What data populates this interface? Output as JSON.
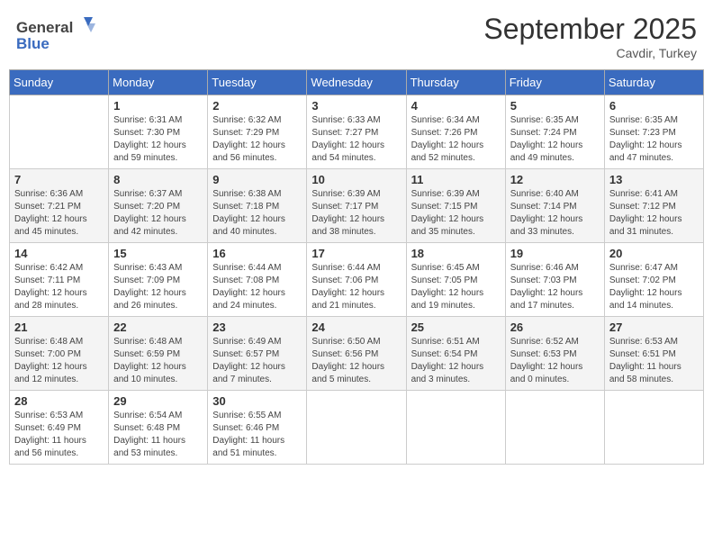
{
  "header": {
    "logo_general": "General",
    "logo_blue": "Blue",
    "month_title": "September 2025",
    "subtitle": "Cavdir, Turkey"
  },
  "weekdays": [
    "Sunday",
    "Monday",
    "Tuesday",
    "Wednesday",
    "Thursday",
    "Friday",
    "Saturday"
  ],
  "weeks": [
    [
      {
        "day": "",
        "sunrise": "",
        "sunset": "",
        "daylight": ""
      },
      {
        "day": "1",
        "sunrise": "Sunrise: 6:31 AM",
        "sunset": "Sunset: 7:30 PM",
        "daylight": "Daylight: 12 hours and 59 minutes."
      },
      {
        "day": "2",
        "sunrise": "Sunrise: 6:32 AM",
        "sunset": "Sunset: 7:29 PM",
        "daylight": "Daylight: 12 hours and 56 minutes."
      },
      {
        "day": "3",
        "sunrise": "Sunrise: 6:33 AM",
        "sunset": "Sunset: 7:27 PM",
        "daylight": "Daylight: 12 hours and 54 minutes."
      },
      {
        "day": "4",
        "sunrise": "Sunrise: 6:34 AM",
        "sunset": "Sunset: 7:26 PM",
        "daylight": "Daylight: 12 hours and 52 minutes."
      },
      {
        "day": "5",
        "sunrise": "Sunrise: 6:35 AM",
        "sunset": "Sunset: 7:24 PM",
        "daylight": "Daylight: 12 hours and 49 minutes."
      },
      {
        "day": "6",
        "sunrise": "Sunrise: 6:35 AM",
        "sunset": "Sunset: 7:23 PM",
        "daylight": "Daylight: 12 hours and 47 minutes."
      }
    ],
    [
      {
        "day": "7",
        "sunrise": "Sunrise: 6:36 AM",
        "sunset": "Sunset: 7:21 PM",
        "daylight": "Daylight: 12 hours and 45 minutes."
      },
      {
        "day": "8",
        "sunrise": "Sunrise: 6:37 AM",
        "sunset": "Sunset: 7:20 PM",
        "daylight": "Daylight: 12 hours and 42 minutes."
      },
      {
        "day": "9",
        "sunrise": "Sunrise: 6:38 AM",
        "sunset": "Sunset: 7:18 PM",
        "daylight": "Daylight: 12 hours and 40 minutes."
      },
      {
        "day": "10",
        "sunrise": "Sunrise: 6:39 AM",
        "sunset": "Sunset: 7:17 PM",
        "daylight": "Daylight: 12 hours and 38 minutes."
      },
      {
        "day": "11",
        "sunrise": "Sunrise: 6:39 AM",
        "sunset": "Sunset: 7:15 PM",
        "daylight": "Daylight: 12 hours and 35 minutes."
      },
      {
        "day": "12",
        "sunrise": "Sunrise: 6:40 AM",
        "sunset": "Sunset: 7:14 PM",
        "daylight": "Daylight: 12 hours and 33 minutes."
      },
      {
        "day": "13",
        "sunrise": "Sunrise: 6:41 AM",
        "sunset": "Sunset: 7:12 PM",
        "daylight": "Daylight: 12 hours and 31 minutes."
      }
    ],
    [
      {
        "day": "14",
        "sunrise": "Sunrise: 6:42 AM",
        "sunset": "Sunset: 7:11 PM",
        "daylight": "Daylight: 12 hours and 28 minutes."
      },
      {
        "day": "15",
        "sunrise": "Sunrise: 6:43 AM",
        "sunset": "Sunset: 7:09 PM",
        "daylight": "Daylight: 12 hours and 26 minutes."
      },
      {
        "day": "16",
        "sunrise": "Sunrise: 6:44 AM",
        "sunset": "Sunset: 7:08 PM",
        "daylight": "Daylight: 12 hours and 24 minutes."
      },
      {
        "day": "17",
        "sunrise": "Sunrise: 6:44 AM",
        "sunset": "Sunset: 7:06 PM",
        "daylight": "Daylight: 12 hours and 21 minutes."
      },
      {
        "day": "18",
        "sunrise": "Sunrise: 6:45 AM",
        "sunset": "Sunset: 7:05 PM",
        "daylight": "Daylight: 12 hours and 19 minutes."
      },
      {
        "day": "19",
        "sunrise": "Sunrise: 6:46 AM",
        "sunset": "Sunset: 7:03 PM",
        "daylight": "Daylight: 12 hours and 17 minutes."
      },
      {
        "day": "20",
        "sunrise": "Sunrise: 6:47 AM",
        "sunset": "Sunset: 7:02 PM",
        "daylight": "Daylight: 12 hours and 14 minutes."
      }
    ],
    [
      {
        "day": "21",
        "sunrise": "Sunrise: 6:48 AM",
        "sunset": "Sunset: 7:00 PM",
        "daylight": "Daylight: 12 hours and 12 minutes."
      },
      {
        "day": "22",
        "sunrise": "Sunrise: 6:48 AM",
        "sunset": "Sunset: 6:59 PM",
        "daylight": "Daylight: 12 hours and 10 minutes."
      },
      {
        "day": "23",
        "sunrise": "Sunrise: 6:49 AM",
        "sunset": "Sunset: 6:57 PM",
        "daylight": "Daylight: 12 hours and 7 minutes."
      },
      {
        "day": "24",
        "sunrise": "Sunrise: 6:50 AM",
        "sunset": "Sunset: 6:56 PM",
        "daylight": "Daylight: 12 hours and 5 minutes."
      },
      {
        "day": "25",
        "sunrise": "Sunrise: 6:51 AM",
        "sunset": "Sunset: 6:54 PM",
        "daylight": "Daylight: 12 hours and 3 minutes."
      },
      {
        "day": "26",
        "sunrise": "Sunrise: 6:52 AM",
        "sunset": "Sunset: 6:53 PM",
        "daylight": "Daylight: 12 hours and 0 minutes."
      },
      {
        "day": "27",
        "sunrise": "Sunrise: 6:53 AM",
        "sunset": "Sunset: 6:51 PM",
        "daylight": "Daylight: 11 hours and 58 minutes."
      }
    ],
    [
      {
        "day": "28",
        "sunrise": "Sunrise: 6:53 AM",
        "sunset": "Sunset: 6:49 PM",
        "daylight": "Daylight: 11 hours and 56 minutes."
      },
      {
        "day": "29",
        "sunrise": "Sunrise: 6:54 AM",
        "sunset": "Sunset: 6:48 PM",
        "daylight": "Daylight: 11 hours and 53 minutes."
      },
      {
        "day": "30",
        "sunrise": "Sunrise: 6:55 AM",
        "sunset": "Sunset: 6:46 PM",
        "daylight": "Daylight: 11 hours and 51 minutes."
      },
      {
        "day": "",
        "sunrise": "",
        "sunset": "",
        "daylight": ""
      },
      {
        "day": "",
        "sunrise": "",
        "sunset": "",
        "daylight": ""
      },
      {
        "day": "",
        "sunrise": "",
        "sunset": "",
        "daylight": ""
      },
      {
        "day": "",
        "sunrise": "",
        "sunset": "",
        "daylight": ""
      }
    ]
  ]
}
